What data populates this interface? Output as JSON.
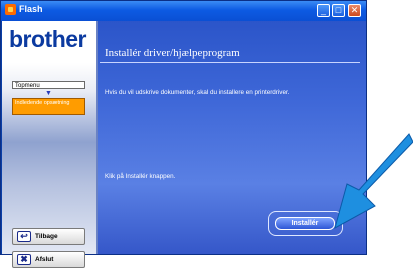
{
  "window": {
    "title": "Flash",
    "minimize": "_",
    "maximize": "□",
    "close": "✕"
  },
  "sidebar": {
    "logo": "brother",
    "topmenu_label": "Topmenu",
    "topmenu_arrow": "▼",
    "initial_setup_label": "Indledende opsætning",
    "back_label": "Tilbage",
    "exit_label": "Afslut",
    "back_icon": "↩",
    "exit_icon": "✖"
  },
  "content": {
    "heading": "Installér driver/hjælpeprogram",
    "description": "Hvis du vil udskrive dokumenter, skal du installere en printerdriver.",
    "hint": "Klik på Installér knappen.",
    "install_label": "Installér"
  },
  "colors": {
    "accent_arrow": "#1e8fe0",
    "content_bg": "#3f68d8",
    "orange": "#ff9c00"
  }
}
